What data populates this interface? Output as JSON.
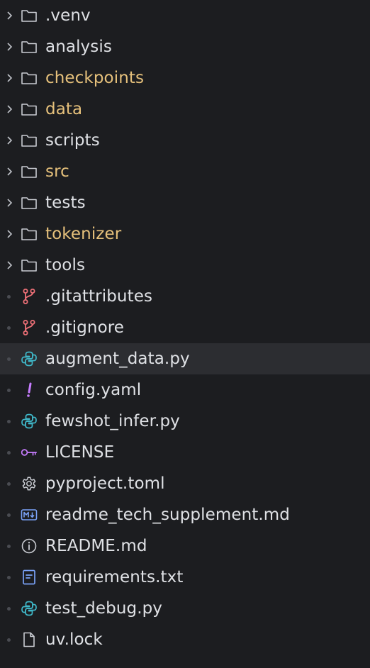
{
  "explorer": {
    "folders": [
      {
        "label": ".venv",
        "modified": false
      },
      {
        "label": "analysis",
        "modified": false
      },
      {
        "label": "checkpoints",
        "modified": true
      },
      {
        "label": "data",
        "modified": true
      },
      {
        "label": "scripts",
        "modified": false
      },
      {
        "label": "src",
        "modified": true
      },
      {
        "label": "tests",
        "modified": false
      },
      {
        "label": "tokenizer",
        "modified": true
      },
      {
        "label": "tools",
        "modified": false
      }
    ],
    "files": [
      {
        "label": ".gitattributes",
        "icon": "git-branch-icon"
      },
      {
        "label": ".gitignore",
        "icon": "git-branch-icon"
      },
      {
        "label": "augment_data.py",
        "icon": "python-icon",
        "selected": true
      },
      {
        "label": "config.yaml",
        "icon": "yaml-exclamation-icon"
      },
      {
        "label": "fewshot_infer.py",
        "icon": "python-icon"
      },
      {
        "label": "LICENSE",
        "icon": "key-icon"
      },
      {
        "label": "pyproject.toml",
        "icon": "gear-icon"
      },
      {
        "label": "readme_tech_supplement.md",
        "icon": "markdown-icon"
      },
      {
        "label": "README.md",
        "icon": "info-icon"
      },
      {
        "label": "requirements.txt",
        "icon": "text-file-icon"
      },
      {
        "label": "test_debug.py",
        "icon": "python-icon"
      },
      {
        "label": "uv.lock",
        "icon": "file-icon"
      }
    ]
  },
  "colors": {
    "background": "#1c1d20",
    "selected_row": "#2c2d31",
    "text": "#dfe1e5",
    "modified_text": "#e5c07b",
    "git_icon": "#f07178",
    "python_icon": "#3fb8c9",
    "yaml_icon": "#c77dff",
    "license_icon": "#c77dff",
    "markdown_icon": "#7aa2f7"
  }
}
